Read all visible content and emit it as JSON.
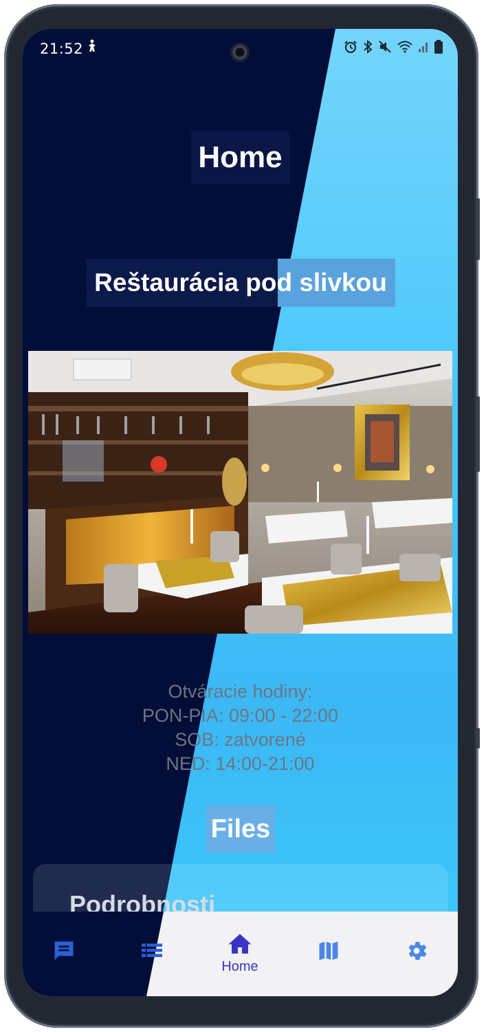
{
  "status_bar": {
    "time": "21:52",
    "notification_icon": "figure-icon",
    "right_icons": [
      "alarm-icon",
      "bluetooth-icon",
      "mute-icon",
      "wifi-icon",
      "signal-icon",
      "battery-icon"
    ]
  },
  "page": {
    "title": "Home",
    "restaurant_name": "Reštaurácia pod slivkou",
    "photo_alt": "restaurant-interior-photo",
    "hours": [
      "Otváracie hodiny:",
      "PON-PIA: 09:00 - 22:00",
      "SOB: zatvorené",
      "NED: 14:00-21:00"
    ],
    "files_heading": "Files",
    "card_title": "Podrobnosti"
  },
  "bottom_nav": {
    "items": [
      {
        "icon": "chat-icon",
        "label": ""
      },
      {
        "icon": "list-icon",
        "label": ""
      },
      {
        "icon": "home-icon",
        "label": "Home"
      },
      {
        "icon": "map-icon",
        "label": ""
      },
      {
        "icon": "settings-icon",
        "label": ""
      }
    ]
  },
  "colors": {
    "dark_navy": "#020e38",
    "sky_blue": "#4cc6fb",
    "nav_active": "#3a34c8",
    "nav_icon": "#3f7fe8"
  }
}
